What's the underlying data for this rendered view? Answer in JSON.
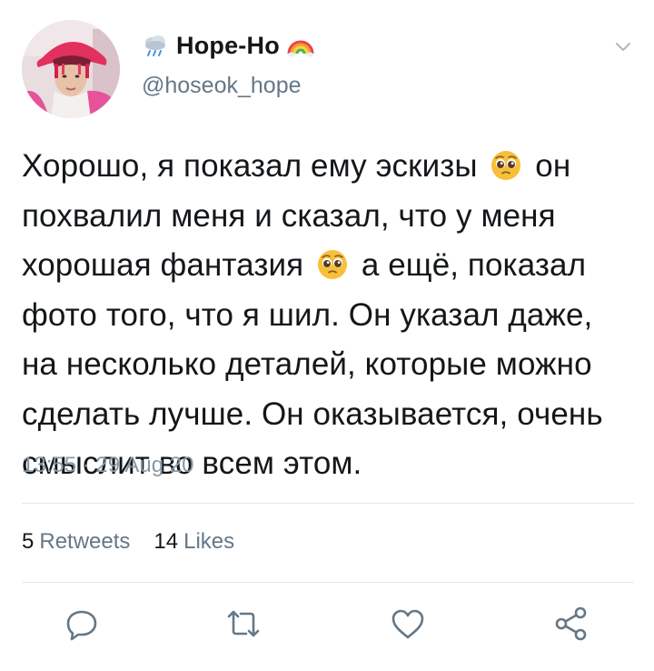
{
  "tweet": {
    "display_name": "Hope-Ho",
    "handle": "@hoseok_hope",
    "name_prefix_icon": "cloud-rain-icon",
    "name_suffix_icon": "rainbow-icon",
    "text_lines": [
      {
        "before": "Хорошо, я показал ему эскизы",
        "emoji": "pleading-face-emoji",
        "after": "он"
      },
      {
        "before": "похвалил меня и сказал, что у меня",
        "emoji": null,
        "after": ""
      },
      {
        "before": "хорошая фантазия",
        "emoji": "pleading-face-emoji",
        "after": "а ещё, показал"
      },
      {
        "before": "фото того, что я шил. Он указал даже,",
        "emoji": null,
        "after": ""
      },
      {
        "before": "на несколько деталей, которые можно",
        "emoji": null,
        "after": ""
      },
      {
        "before": "сделать лучше. Он оказывается, очень",
        "emoji": null,
        "after": ""
      },
      {
        "before": "смыслит во всем этом.",
        "emoji": null,
        "after": ""
      }
    ],
    "timestamp": "13:55 · 29 Aug 20",
    "retweets_count": "5",
    "retweets_label": "Retweets",
    "likes_count": "14",
    "likes_label": "Likes"
  },
  "actions": [
    {
      "name": "reply",
      "icon": "reply-icon"
    },
    {
      "name": "retweet",
      "icon": "retweet-icon"
    },
    {
      "name": "like",
      "icon": "heart-icon"
    },
    {
      "name": "share",
      "icon": "share-icon"
    }
  ],
  "colors": {
    "text": "#14171a",
    "secondary": "#657786",
    "timestamp": "#8899a6",
    "icon_gray": "#657786",
    "divider": "#e1e8ed",
    "emoji_face": "#f7c03a"
  }
}
